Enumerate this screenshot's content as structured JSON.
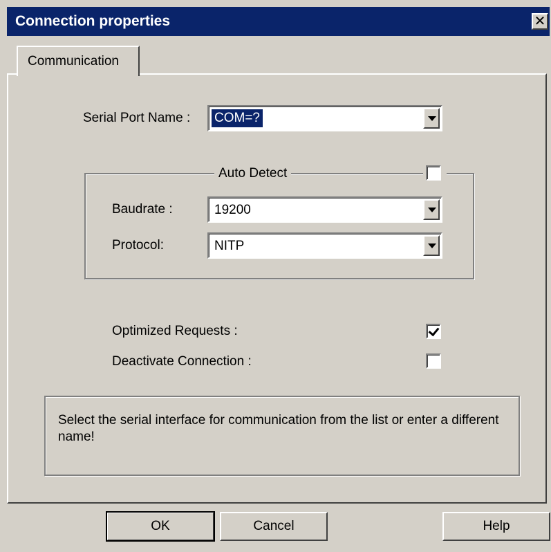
{
  "window": {
    "title": "Connection properties",
    "close_glyph": "✕"
  },
  "tabs": [
    {
      "label": "Communication",
      "active": true
    }
  ],
  "serial_port": {
    "label": "Serial Port Name :",
    "value": "COM=?",
    "text_selected": true
  },
  "auto_detect": {
    "label": "Auto Detect",
    "checked": false,
    "baudrate": {
      "label": "Baudrate :",
      "value": "19200"
    },
    "protocol": {
      "label": "Protocol:",
      "value": "NITP"
    }
  },
  "options": {
    "optimized_requests": {
      "label": "Optimized Requests :",
      "checked": true
    },
    "deactivate_connection": {
      "label": "Deactivate Connection :",
      "checked": false
    }
  },
  "info": {
    "text": "Select the serial interface for communication from the list or enter a different name!"
  },
  "buttons": {
    "ok": "OK",
    "cancel": "Cancel",
    "help": "Help"
  },
  "colors": {
    "titlebar": "#0a246a",
    "face": "#d4d0c8",
    "selection": "#0a246a"
  },
  "icons": {
    "close": "close-icon",
    "dropdown": "chevron-down-icon",
    "check": "check-icon"
  }
}
